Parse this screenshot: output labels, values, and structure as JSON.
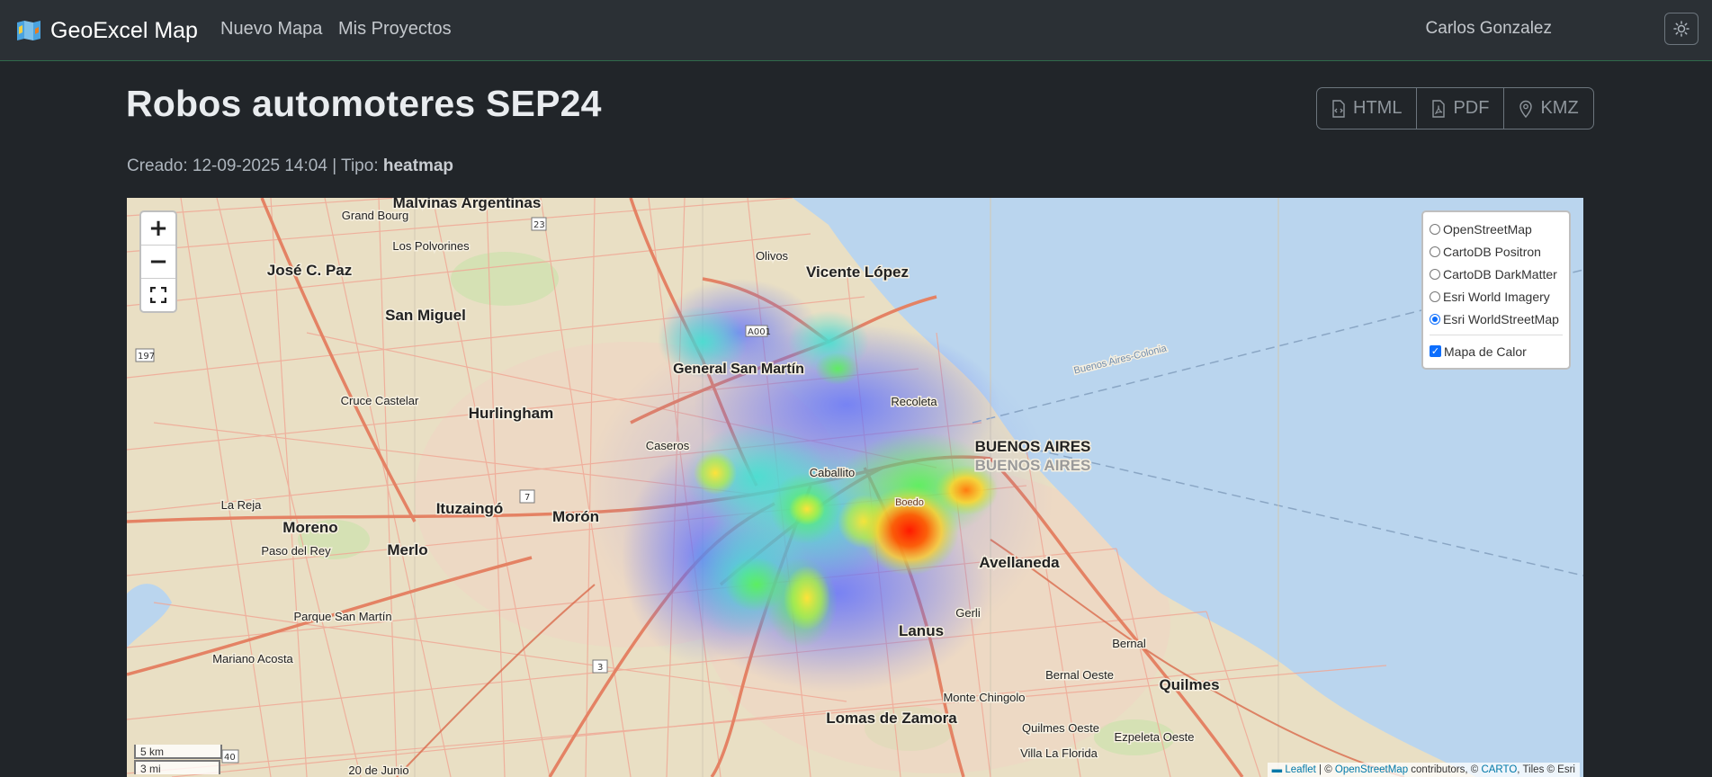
{
  "navbar": {
    "brand": "GeoExcel Map",
    "links": [
      "Nuevo Mapa",
      "Mis Proyectos"
    ],
    "user": "Carlos Gonzalez",
    "theme_icon": "sun-icon"
  },
  "project": {
    "title": "Robos automoteres SEP24",
    "created_label": "Creado:",
    "created": "12-09-2025 14:04",
    "type_label": "| Tipo:",
    "type": "heatmap"
  },
  "exports": [
    {
      "label": "HTML",
      "icon": "file-code-icon"
    },
    {
      "label": "PDF",
      "icon": "file-pdf-icon"
    },
    {
      "label": "KMZ",
      "icon": "map-pin-icon"
    }
  ],
  "map": {
    "zoom_in": "+",
    "zoom_out": "−",
    "basemaps": [
      {
        "label": "OpenStreetMap",
        "selected": false
      },
      {
        "label": "CartoDB Positron",
        "selected": false
      },
      {
        "label": "CartoDB DarkMatter",
        "selected": false
      },
      {
        "label": "Esri World Imagery",
        "selected": false
      },
      {
        "label": "Esri WorldStreetMap",
        "selected": true
      }
    ],
    "overlays": [
      {
        "label": "Mapa de Calor",
        "checked": true
      }
    ],
    "scale": {
      "metric": "5 km",
      "imperial": "3 mi"
    },
    "attribution": {
      "leaflet": "Leaflet",
      "osm_prefix": "| © ",
      "osm": "OpenStreetMap",
      "osm_suffix": " contributors, © ",
      "carto": "CARTO",
      "esri": ", Tiles © Esri"
    },
    "places": [
      "Malvinas Argentinas",
      "Grand Bourg",
      "José C. Paz",
      "Los Polvorines",
      "San Miguel",
      "Olivos",
      "Vicente López",
      "General San Martín",
      "Hurlingham",
      "Cruce Castelar",
      "Recoleta",
      "Caseros",
      "BUENOS AIRES",
      "Caballito",
      "La Reja",
      "Moreno",
      "Ituzaingó",
      "Morón",
      "Paso del Rey",
      "Merlo",
      "Avellaneda",
      "Parque San Martín",
      "Lanus",
      "Gerli",
      "Mariano Acosta",
      "Bernal",
      "Bernal Oeste",
      "Quilmes",
      "Monte Chingolo",
      "Lomas de Zamora",
      "Quilmes Oeste",
      "Ezpeleta Oeste",
      "Villa La Florida",
      "20 de Junio",
      "Buenos Aires-Colonia",
      "Boedo"
    ],
    "heat_points": [
      {
        "lat": -34.56,
        "lng": -58.52,
        "intensity": 0.4
      },
      {
        "lat": -34.61,
        "lng": -58.56,
        "intensity": 0.7
      },
      {
        "lat": -34.63,
        "lng": -58.42,
        "intensity": 1.0
      },
      {
        "lat": -34.62,
        "lng": -58.4,
        "intensity": 0.8
      },
      {
        "lat": -34.67,
        "lng": -58.48,
        "intensity": 0.7
      },
      {
        "lat": -34.62,
        "lng": -58.47,
        "intensity": 0.5
      }
    ]
  }
}
